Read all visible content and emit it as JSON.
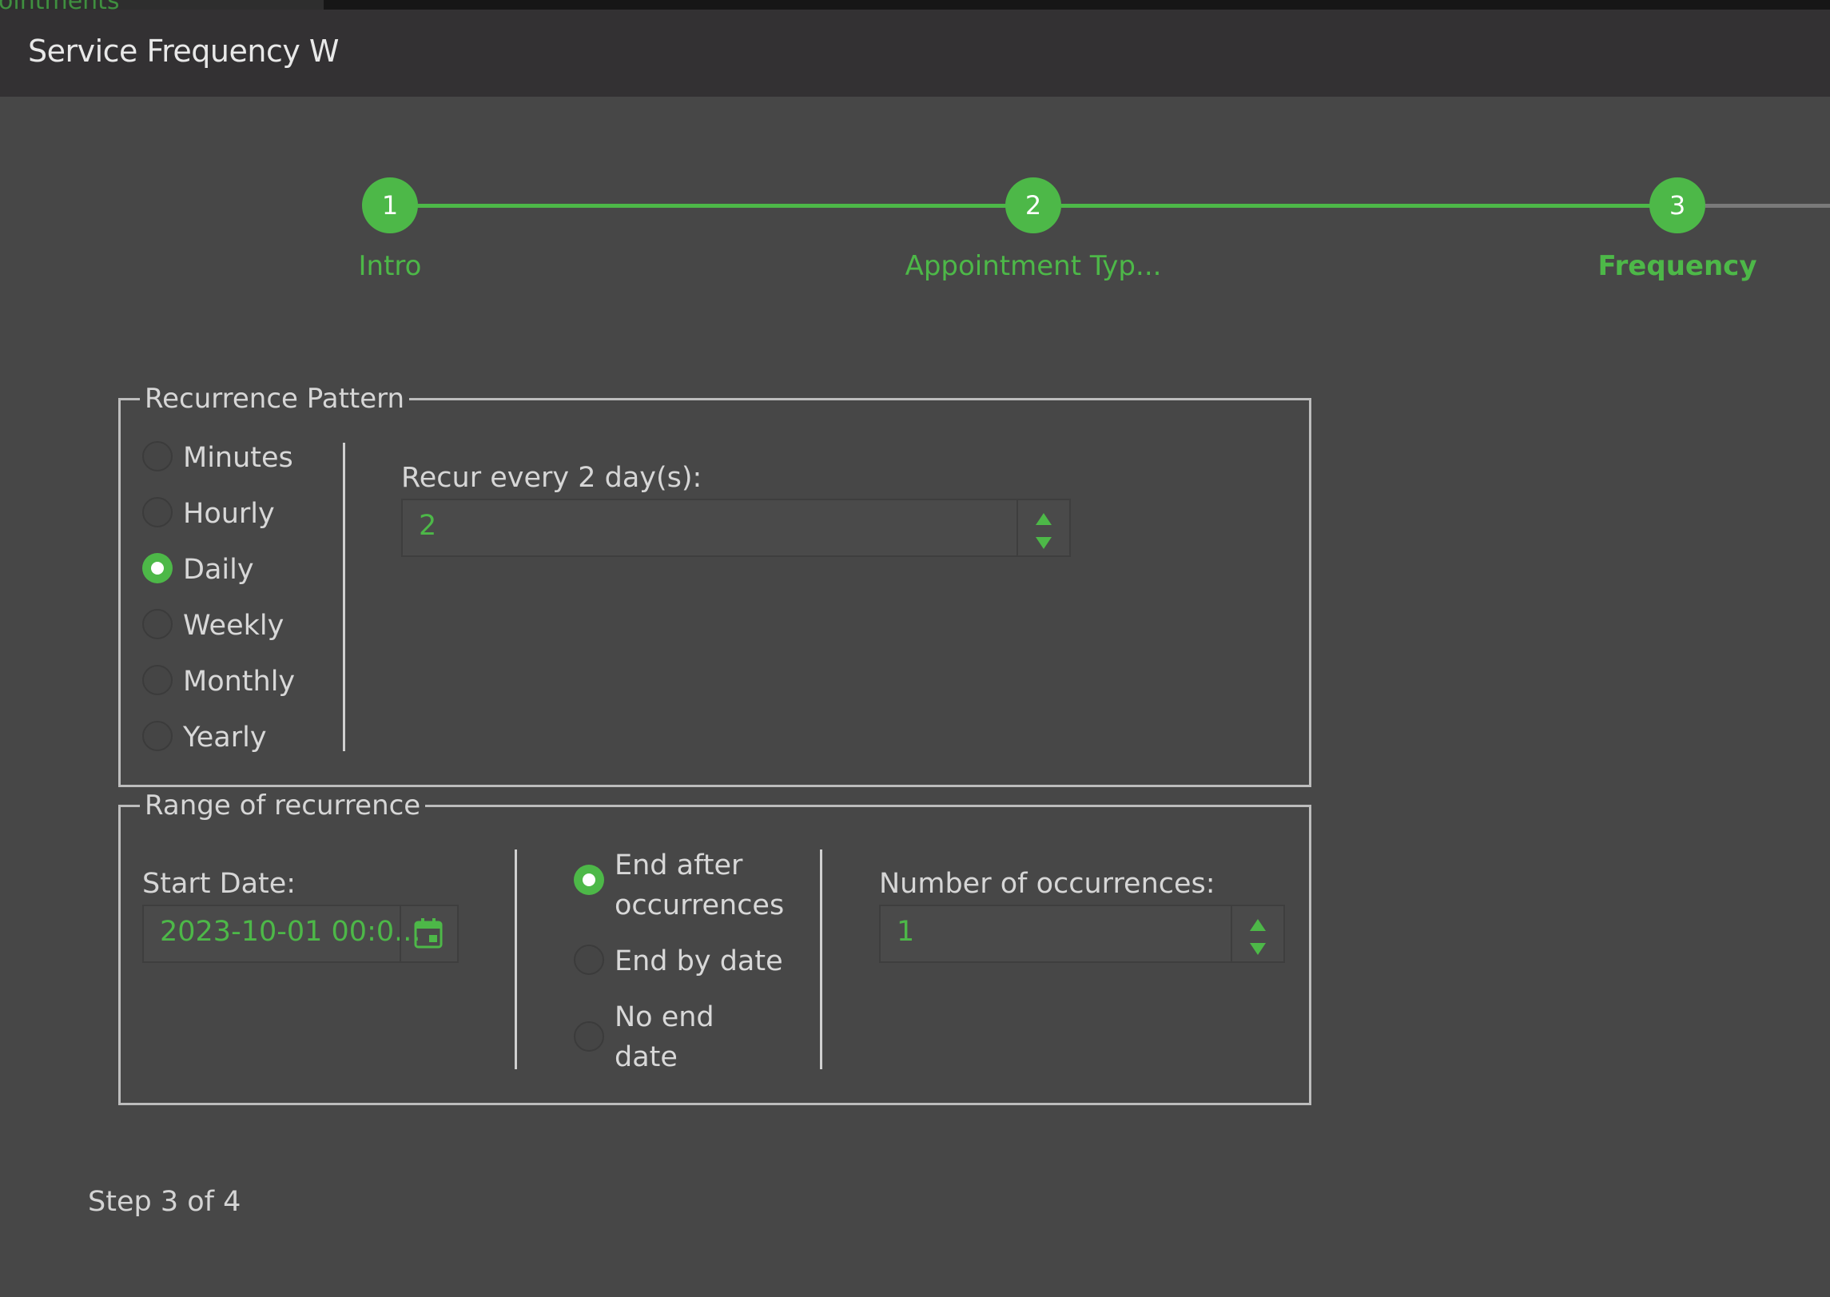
{
  "background_window": {
    "tab_text": "ointments"
  },
  "window": {
    "title": "Service Frequency W"
  },
  "wizard": {
    "steps": [
      {
        "number": "1",
        "label": "Intro",
        "state": "completed"
      },
      {
        "number": "2",
        "label": "Appointment Typ...",
        "state": "completed"
      },
      {
        "number": "3",
        "label": "Frequency",
        "state": "current"
      }
    ],
    "step_indicator": "Step 3 of 4"
  },
  "recurrence_pattern": {
    "legend": "Recurrence Pattern",
    "options": [
      {
        "label": "Minutes",
        "selected": false
      },
      {
        "label": "Hourly",
        "selected": false
      },
      {
        "label": "Daily",
        "selected": true
      },
      {
        "label": "Weekly",
        "selected": false
      },
      {
        "label": "Monthly",
        "selected": false
      },
      {
        "label": "Yearly",
        "selected": false
      }
    ],
    "recur_label": "Recur every 2 day(s):",
    "recur_value": "2"
  },
  "range": {
    "legend": "Range of recurrence",
    "start_label": "Start Date:",
    "start_value": "2023-10-01 00:0...",
    "end_options": [
      {
        "line1": "End after",
        "line2": "occurrences",
        "selected": true
      },
      {
        "line1": "End by date",
        "line2": "",
        "selected": false
      },
      {
        "line1": "No end",
        "line2": "date",
        "selected": false
      }
    ],
    "occurrences_label": "Number of occurrences:",
    "occurrences_value": "1"
  },
  "colors": {
    "accent": "#4db848",
    "background": "#474747",
    "titlebar": "#333133",
    "border": "#bdbdbd"
  },
  "icons": {
    "calendar": "calendar-icon",
    "spin_up": "triangle-up",
    "spin_down": "triangle-down"
  }
}
